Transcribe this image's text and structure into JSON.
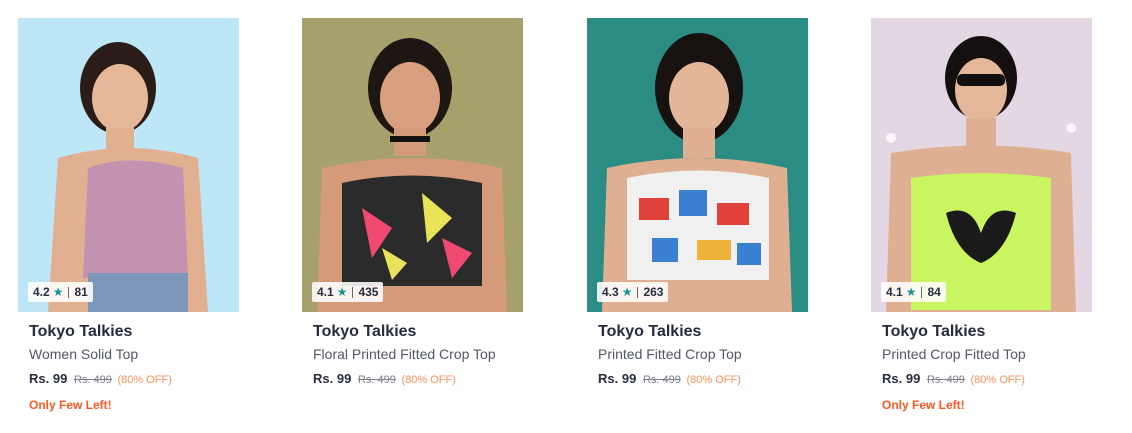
{
  "products": [
    {
      "brand": "Tokyo Talkies",
      "name": "Women Solid Top",
      "price": "Rs. 99",
      "mrp": "Rs. 499",
      "discount": "(80% OFF)",
      "rating": "4.2",
      "rating_count": "81",
      "badge": "Only Few Left!",
      "bg": "#bde7f7",
      "top_color": "#c492b1",
      "icon": "star-icon"
    },
    {
      "brand": "Tokyo Talkies",
      "name": "Floral Printed Fitted Crop Top",
      "price": "Rs. 99",
      "mrp": "Rs. 499",
      "discount": "(80% OFF)",
      "rating": "4.1",
      "rating_count": "435",
      "badge": "",
      "bg": "#a6a06b",
      "top_color": "#2b2b2b",
      "icon": "star-icon"
    },
    {
      "brand": "Tokyo Talkies",
      "name": "Printed Fitted Crop Top",
      "price": "Rs. 99",
      "mrp": "Rs. 499",
      "discount": "(80% OFF)",
      "rating": "4.3",
      "rating_count": "263",
      "badge": "",
      "bg": "#2b8c84",
      "top_color": "#f0f0f0",
      "icon": "star-icon"
    },
    {
      "brand": "Tokyo Talkies",
      "name": "Printed Crop Fitted Top",
      "price": "Rs. 99",
      "mrp": "Rs. 499",
      "discount": "(80% OFF)",
      "rating": "4.1",
      "rating_count": "84",
      "badge": "Only Few Left!",
      "bg": "#e3d7e4",
      "top_color": "#c8f560",
      "icon": "star-icon"
    }
  ]
}
